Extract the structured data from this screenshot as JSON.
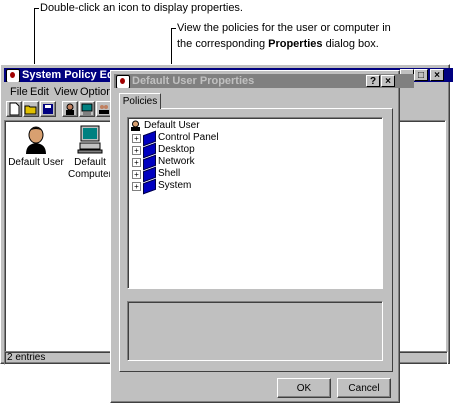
{
  "callouts": {
    "top": "Double-click an icon to display properties.",
    "second_line1": "View the policies for the user or computer in",
    "second_line2_prefix": "the corresponding ",
    "second_line2_bold": "Properties",
    "second_line2_suffix": " dialog box."
  },
  "main_window": {
    "title": "System Policy Editor - (Untitled)",
    "menu": [
      "File",
      "Edit",
      "View",
      "Options"
    ],
    "icons": [
      {
        "label_line1": "Default User",
        "label_line2": "",
        "icon": "user-head-icon"
      },
      {
        "label_line1": "Default",
        "label_line2": "Computer",
        "icon": "computer-icon"
      }
    ],
    "status": "2 entries"
  },
  "dialog": {
    "title": "Default User Properties",
    "help_button": "?",
    "close_button": "×",
    "tab": "Policies",
    "tree": {
      "root": "Default User",
      "children": [
        "Control Panel",
        "Desktop",
        "Network",
        "Shell",
        "System"
      ]
    },
    "ok": "OK",
    "cancel": "Cancel"
  }
}
